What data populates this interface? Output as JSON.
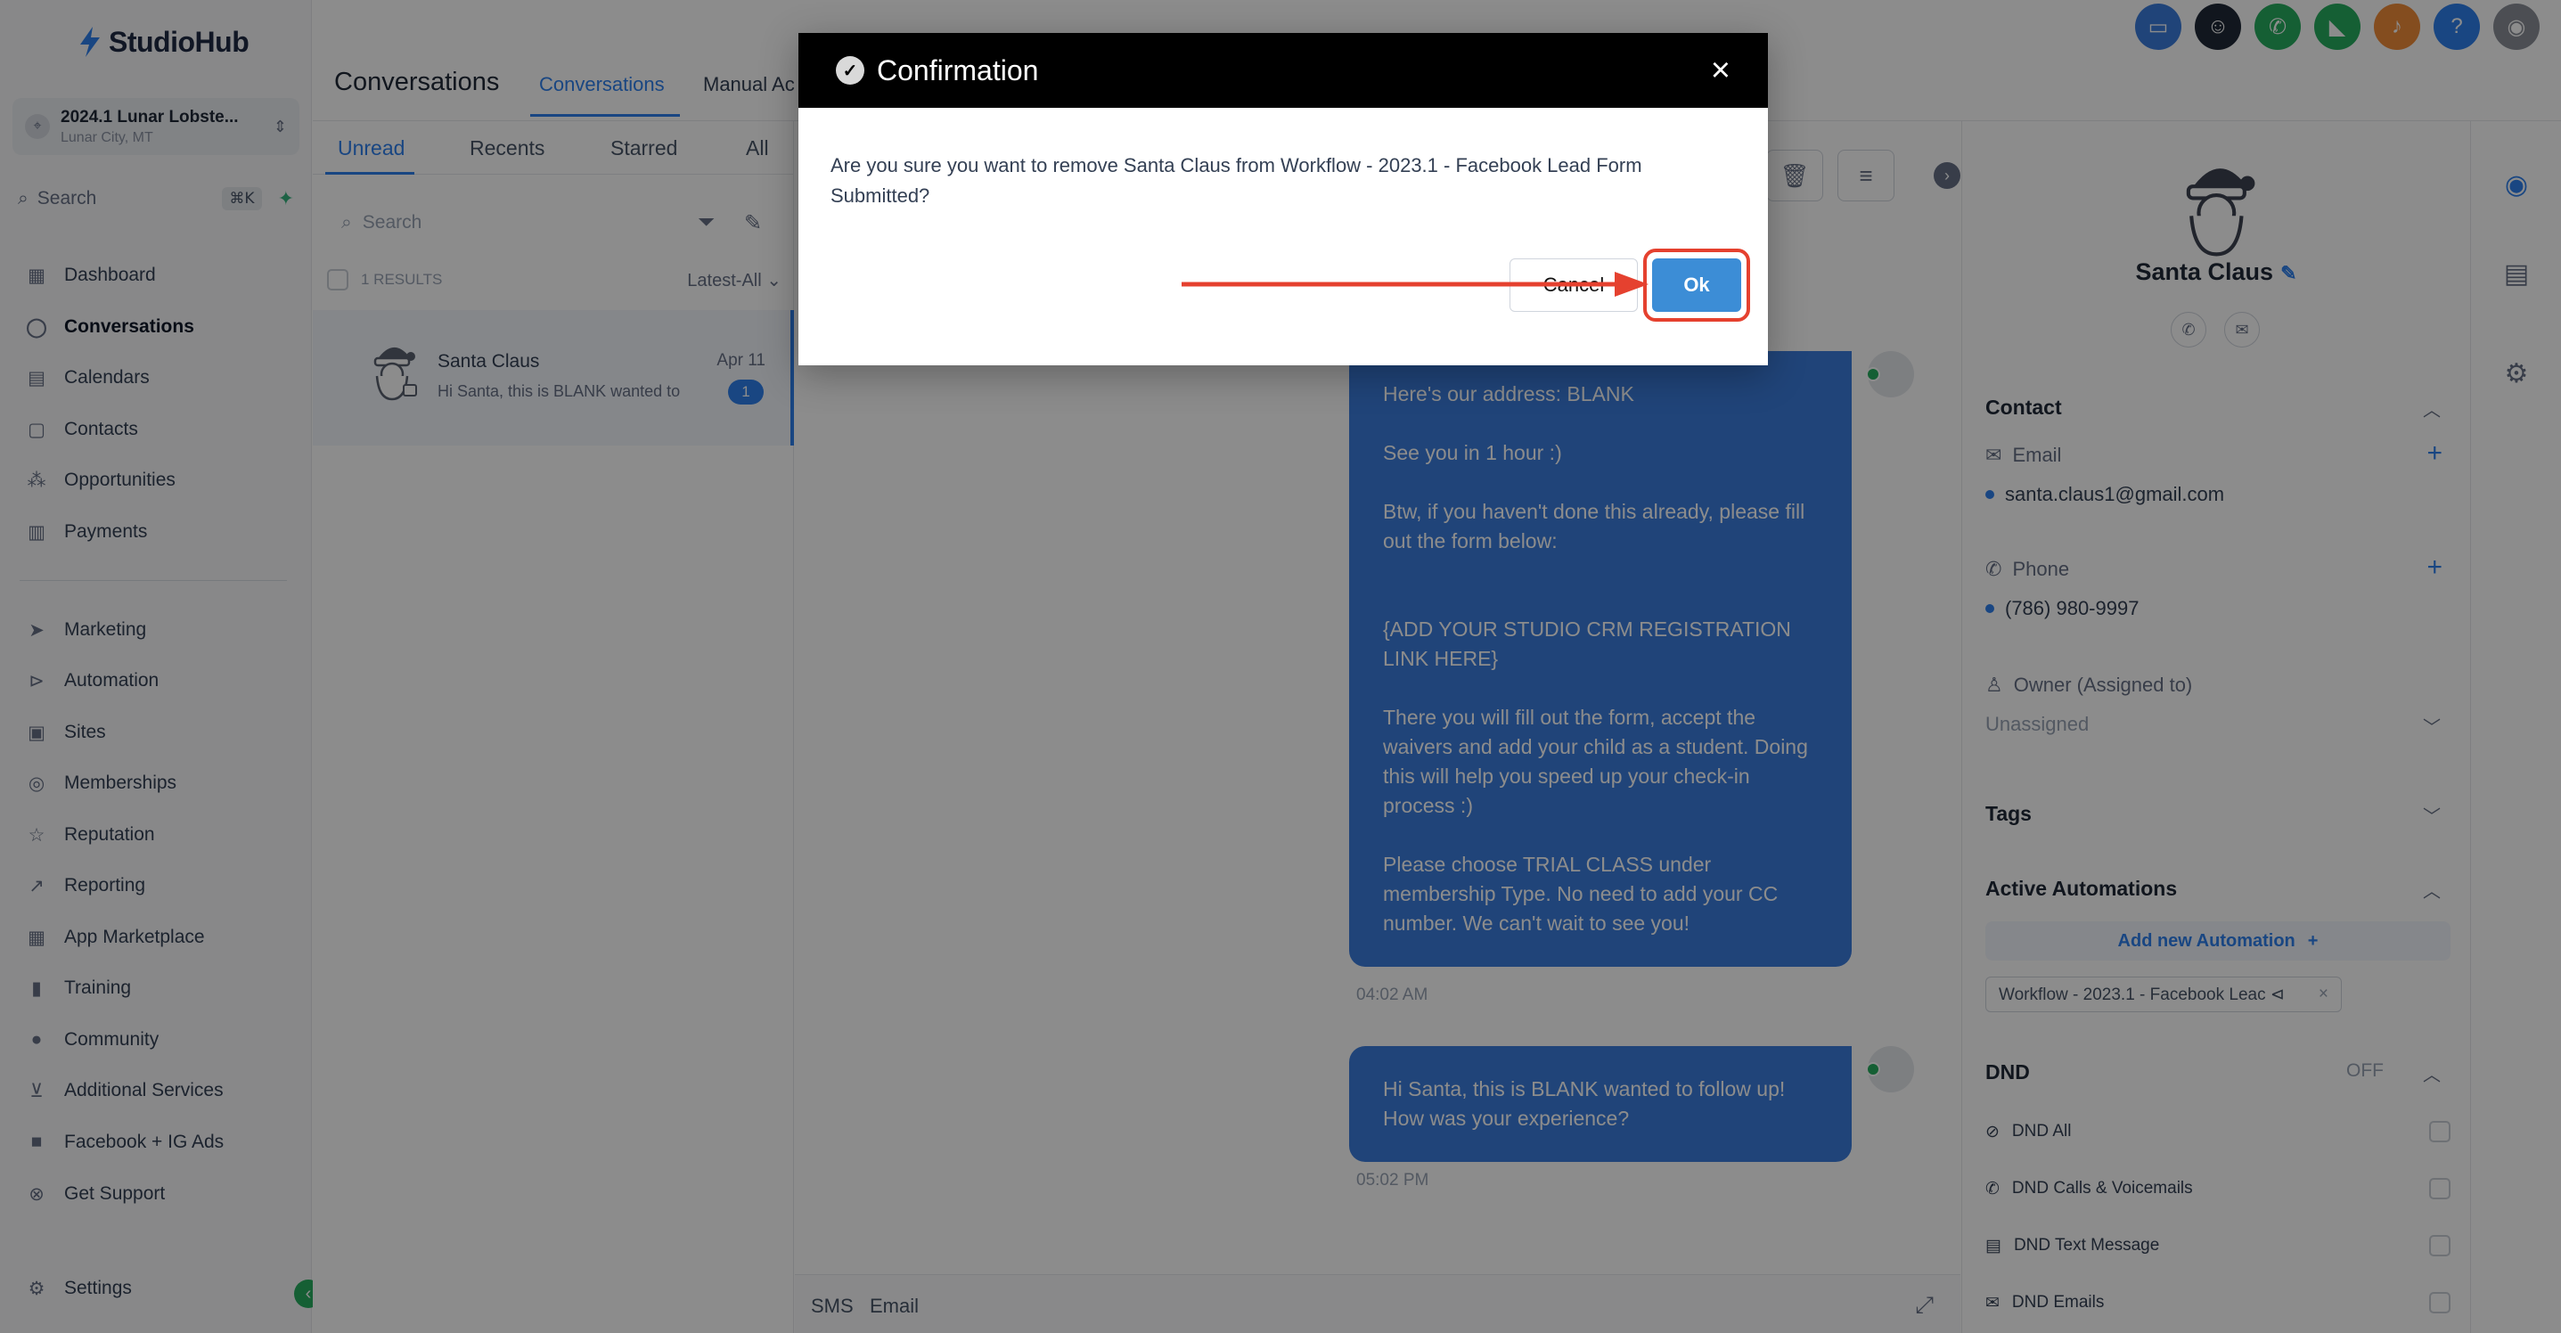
{
  "brand": {
    "name": "StudioHub"
  },
  "location": {
    "name": "2024.1 Lunar Lobste...",
    "sub": "Lunar City, MT"
  },
  "sidebar": {
    "search_label": "Search",
    "search_shortcut": "⌘K",
    "items": [
      {
        "label": "Dashboard",
        "icon": "grid-icon"
      },
      {
        "label": "Conversations",
        "icon": "chat-icon"
      },
      {
        "label": "Calendars",
        "icon": "calendar-icon"
      },
      {
        "label": "Contacts",
        "icon": "contacts-icon"
      },
      {
        "label": "Opportunities",
        "icon": "funnel-icon"
      },
      {
        "label": "Payments",
        "icon": "receipt-icon"
      },
      {
        "label": "Marketing",
        "icon": "send-icon"
      },
      {
        "label": "Automation",
        "icon": "play-circle-icon"
      },
      {
        "label": "Sites",
        "icon": "browser-icon"
      },
      {
        "label": "Memberships",
        "icon": "badge-icon"
      },
      {
        "label": "Reputation",
        "icon": "star-icon"
      },
      {
        "label": "Reporting",
        "icon": "trend-icon"
      },
      {
        "label": "App Marketplace",
        "icon": "apps-icon"
      },
      {
        "label": "Training",
        "icon": "book-icon"
      },
      {
        "label": "Community",
        "icon": "people-icon"
      },
      {
        "label": "Additional Services",
        "icon": "cart-icon"
      },
      {
        "label": "Facebook + IG Ads",
        "icon": "facebook-icon"
      },
      {
        "label": "Get Support",
        "icon": "lifebuoy-icon"
      }
    ],
    "settings_label": "Settings"
  },
  "header": {
    "title": "Conversations",
    "tabs": [
      "Conversations",
      "Manual Ac"
    ]
  },
  "list": {
    "tabs": [
      "Unread",
      "Recents",
      "Starred",
      "All"
    ],
    "search_placeholder": "Search",
    "results_label": "1 RESULTS",
    "sort_label": "Latest-All",
    "items": [
      {
        "name": "Santa Claus",
        "date": "Apr 11",
        "preview": "Hi Santa, this is BLANK wanted to",
        "unread": "1"
      }
    ]
  },
  "chat": {
    "messages": [
      {
        "paragraphs": [
          "Here's our address: BLANK",
          "See you in 1 hour :)",
          "Btw, if you haven't done this already, please fill out the form below:",
          "",
          "{ADD YOUR STUDIO CRM REGISTRATION LINK HERE}",
          "There you will fill out the form, accept the waivers and add your child as a student. Doing this will help you speed up your check-in process :)",
          "Please choose TRIAL CLASS under membership Type. No need to add your CC number. We can't wait to see you!"
        ],
        "time": "04:02 AM"
      },
      {
        "paragraphs": [
          "Hi Santa, this is BLANK wanted to follow up! How was your experience?"
        ],
        "time": "05:02 PM"
      }
    ],
    "composer_tabs": [
      "SMS",
      "Email"
    ]
  },
  "contact": {
    "name": "Santa Claus",
    "contact_section": "Contact",
    "email_label": "Email",
    "email": "santa.claus1@gmail.com",
    "phone_label": "Phone",
    "phone": "(786) 980-9997",
    "owner_label": "Owner (Assigned to)",
    "owner_value": "Unassigned",
    "tags_section": "Tags",
    "automations_section": "Active Automations",
    "add_automation": "Add new Automation",
    "automation_chip": "Workflow - 2023.1 - Facebook Leac ⊲",
    "dnd_section": "DND",
    "dnd_status": "OFF",
    "dnd_items": [
      "DND All",
      "DND Calls & Voicemails",
      "DND Text Message",
      "DND Emails"
    ]
  },
  "modal": {
    "title": "Confirmation",
    "message": "Are you sure you want to remove Santa Claus from Workflow - 2023.1 - Facebook Lead Form Submitted?",
    "cancel_label": "Cancel",
    "ok_label": "Ok"
  },
  "colors": {
    "accent": "#2f80ed",
    "bubble": "#3b7ddd",
    "annotation": "#e5412f",
    "modal_header": "#000000"
  }
}
